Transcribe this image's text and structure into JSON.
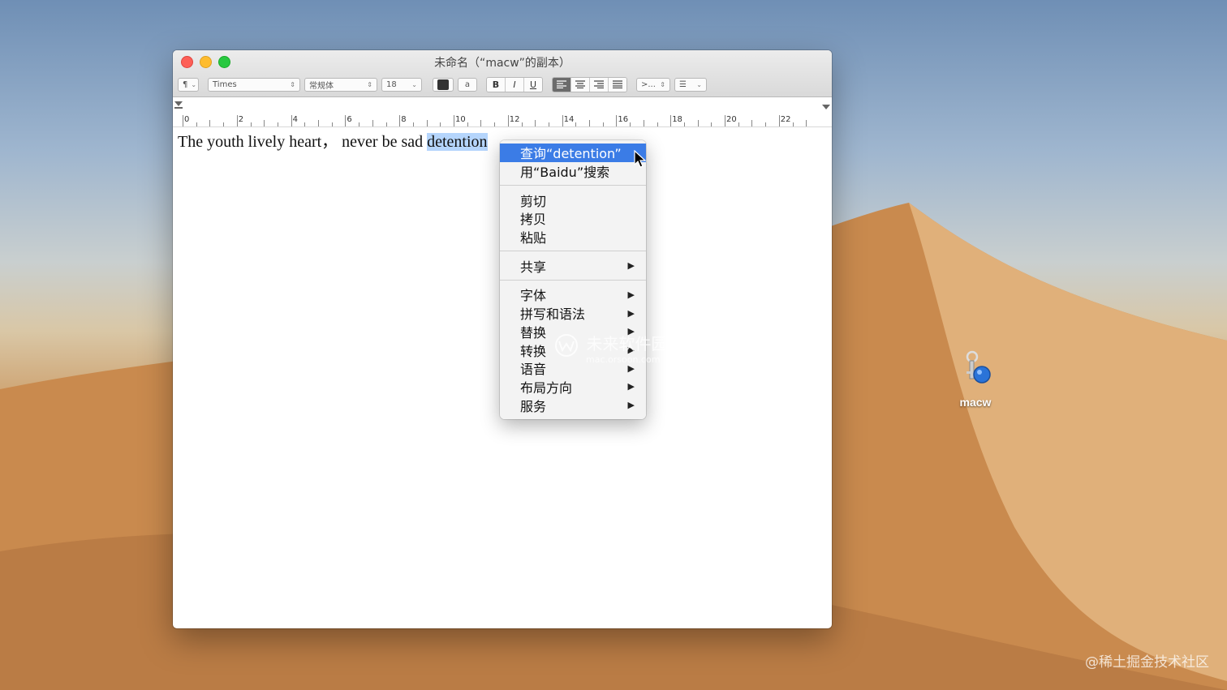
{
  "window": {
    "title": "未命名（“macw”的副本）"
  },
  "toolbar": {
    "paragraph_style": "¶",
    "font_family": "Times",
    "font_style": "常规体",
    "font_size": "18",
    "bg_label": "a",
    "bold": "B",
    "italic": "I",
    "underline": "U",
    "spacing": ">...",
    "list": "☰"
  },
  "ruler": {
    "labels": [
      "0",
      "2",
      "4",
      "6",
      "8",
      "10",
      "12",
      "14",
      "16",
      "18",
      "20",
      "22"
    ]
  },
  "document": {
    "text_before": "The youth lively heart，  never be sad ",
    "selected_text": "detention"
  },
  "context_menu": {
    "lookup": "查询“detention”",
    "search": "用“Baidu”搜索",
    "cut": "剪切",
    "copy": "拷贝",
    "paste": "粘贴",
    "share": "共享",
    "font": "字体",
    "spelling": "拼写和语法",
    "substitutions": "替换",
    "transformations": "转换",
    "speech": "语音",
    "layout": "布局方向",
    "services": "服务"
  },
  "overlay_watermark": {
    "brand": "未来软件园",
    "url": "mac.orsoon.com"
  },
  "desktop": {
    "icon_label": "macw"
  },
  "watermark": "@稀土掘金技术社区",
  "colors": {
    "highlight": "#3b7ce6",
    "selection": "#b5d5fc"
  }
}
